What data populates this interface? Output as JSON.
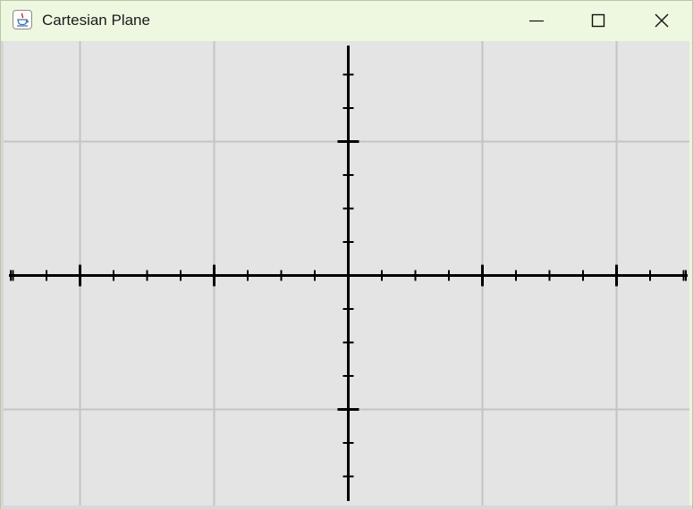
{
  "window": {
    "title": "Cartesian Plane",
    "app_icon": "java-coffee-cup-icon",
    "controls": {
      "minimize_icon": "minimize-icon",
      "maximize_icon": "maximize-icon",
      "close_icon": "close-icon"
    },
    "colors": {
      "titlebar": "#eef8e1",
      "canvas": "#e4e4e4",
      "grid": "#c4c4c4",
      "axes": "#000000"
    }
  },
  "plane": {
    "x_range": [
      -2.5,
      2.5
    ],
    "y_range": [
      -1.68,
      1.68
    ],
    "grid_step": 1,
    "minor_tick_step": 0.25,
    "major_tick_step": 1,
    "grid": true,
    "axes_visible": true
  }
}
